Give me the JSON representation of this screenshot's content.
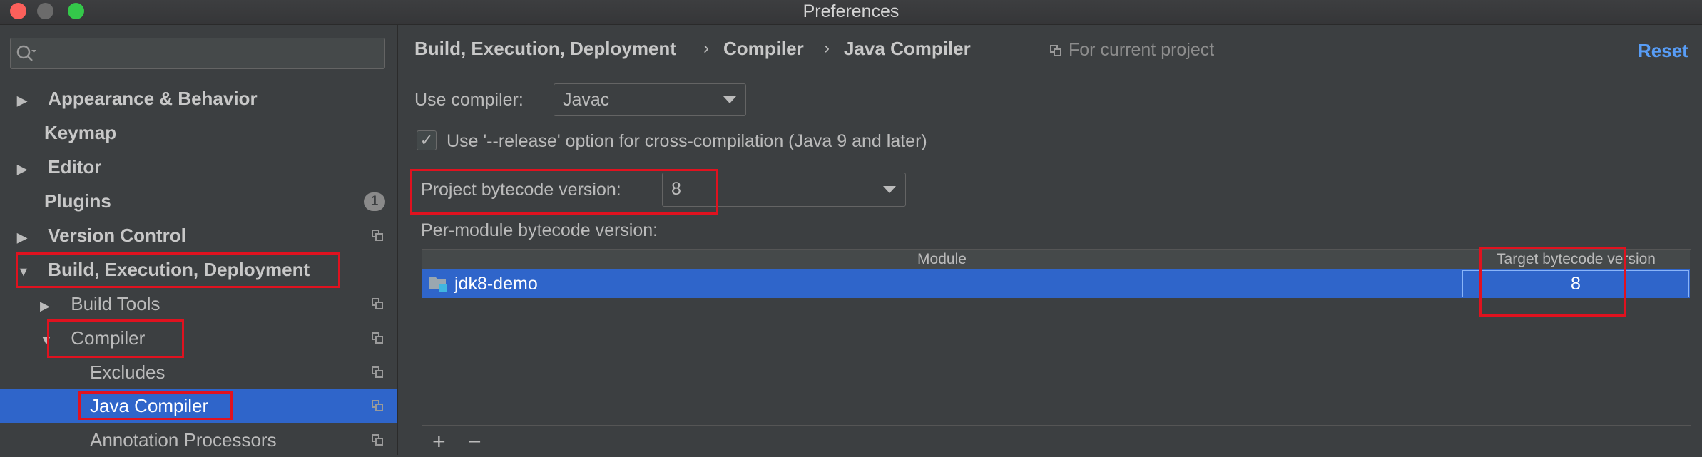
{
  "window": {
    "title": "Preferences",
    "traffic_colors": [
      "#fc605b",
      "#6b6b6b",
      "#34c84a"
    ]
  },
  "sidebar": {
    "search_placeholder": "",
    "items": [
      {
        "label": "Appearance & Behavior",
        "expanded": false
      },
      {
        "label": "Keymap"
      },
      {
        "label": "Editor",
        "expanded": false
      },
      {
        "label": "Plugins",
        "badge": "1"
      },
      {
        "label": "Version Control",
        "expanded": false
      },
      {
        "label": "Build, Execution, Deployment",
        "expanded": true
      },
      {
        "label": "Build Tools",
        "expanded": false
      },
      {
        "label": "Compiler",
        "expanded": true
      },
      {
        "label": "Excludes"
      },
      {
        "label": "Java Compiler",
        "selected": true
      },
      {
        "label": "Annotation Processors"
      }
    ]
  },
  "main": {
    "breadcrumb": [
      "Build, Execution, Deployment",
      "Compiler",
      "Java Compiler"
    ],
    "breadcrumb_sep": "›",
    "for_current_project": "For current project",
    "reset_label": "Reset",
    "use_compiler_label": "Use compiler:",
    "use_compiler_value": "Javac",
    "release_option_label": "Use '--release' option for cross-compilation (Java 9 and later)",
    "release_option_checked": true,
    "project_bytecode_label": "Project bytecode version:",
    "project_bytecode_value": "8",
    "per_module_label": "Per-module bytecode version:",
    "table": {
      "columns": [
        "Module",
        "Target bytecode version"
      ],
      "rows": [
        {
          "module": "jdk8-demo",
          "target": "8"
        }
      ]
    },
    "add_label": "+",
    "remove_label": "−"
  },
  "colors": {
    "background": "#3c3f41",
    "selection": "#2f65ca",
    "accent_link": "#589df6",
    "highlight_box": "#e0121f"
  }
}
